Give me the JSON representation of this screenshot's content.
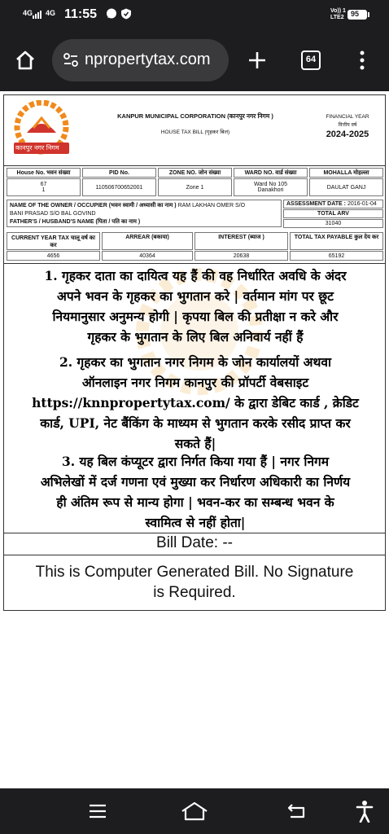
{
  "status_bar": {
    "time": "11:55",
    "signal_1": "4G",
    "signal_2": "4G",
    "volte": "Vo)) 1\nLTE2",
    "battery": "95"
  },
  "browser": {
    "url": "npropertytax.com",
    "tab_count": "64"
  },
  "bill": {
    "org_name": "KANPUR MUNICIPAL CORPORATION (कानपुर नगर निगम )",
    "bill_title": "HOUSE TAX BILL (गृहकर बिल)",
    "logo_text": "कानपुर नगर निगम",
    "financial_year_label": "FINANCIAL YEAR",
    "financial_year_label_hi": "वित्तीय वर्ष",
    "financial_year": "2024-2025",
    "row1_headers": [
      "House No. भवन संख्या",
      "PID No.",
      "ZONE NO. जोन संख्या",
      "WARD NO. वार्ड संख्या",
      "MOHALLA मोहल्ला"
    ],
    "house_no_1": "67",
    "house_no_2": "1",
    "pid_no": "110506700652001",
    "zone_no": "Zone 1",
    "ward_no_1": "Ward No 105",
    "ward_no_2": "Danakhori",
    "mohalla": "DAULAT GANJ",
    "owner_label": "NAME OF THE OWNER / OCCUPIER (भवन स्वामी / अध्यासी का नाम )",
    "owner_name": "RAM LAKHAN OMER S/O",
    "owner_name_2": "BANI PRASAD S/O BAL GOVIND",
    "father_label": "FATHER'S / HUSBAND'S NAME (पिता / पति का नाम )",
    "assessment_label": "ASSESSMENT DATE :",
    "assessment_date": "2016-01-04",
    "total_arv_label": "TOTAL ARV",
    "total_arv": "31040",
    "row3_headers": [
      "CURRENT YEAR TAX चालू वर्ष का कर",
      "ARREAR (बकाया)",
      "INTEREST (ब्याज )",
      "TOTAL TAX PAYABLE कुल देय कर"
    ],
    "current_tax": "4656",
    "arrear": "40364",
    "interest": "20638",
    "total_payable": "65192",
    "note_1_lines": [
      "1. गृहकर दाता का दायित्व यह हैं की वह निर्धारित अवधि के अंदर",
      "अपने भवन के गृहकर का भुगतान करे | वर्तमान मांग पर छूट",
      "नियमानुसार अनुमन्य होगी | कृपया बिल की प्रतीक्षा न करे और",
      "गृहकर के भुगतान के लिए बिल अनिवार्य नहीं हैं"
    ],
    "note_2_lines": [
      "2. गृहकर का भुगतान नगर निगम के जोन कार्यालयों अथवा",
      "ऑनलाइन नगर निगम कानपुर की प्रॉपर्टी वेबसाइट",
      "https://knnpropertytax.com/ के द्वारा डेबिट कार्ड , क्रेडिट",
      "कार्ड, UPI, नेट बैंकिंग के माध्यम से भुगतान करके रसीद प्राप्त कर",
      "सकते हैं|"
    ],
    "note_3_lines": [
      "3. यह बिल कंप्यूटर द्वारा निर्गत किया गया हैं | नगर निगम",
      "अभिलेखों में दर्ज गणना एवं मुख्या कर निर्धारण अधिकारी का निर्णय",
      "ही अंतिम रूप से मान्य होगा | भवन-कर का सम्बन्ध भवन के",
      "स्वामित्व से नहीं होता|"
    ],
    "bill_date": "Bill Date: --",
    "footer_line_1": "This is Computer Generated Bill. No Signature",
    "footer_line_2": "is Required."
  },
  "colors": {
    "dark_bar": "#1d1d1f",
    "url_pill": "#3a3a3c",
    "logo_orange": "#f08a1c",
    "logo_red": "#d0342c",
    "watermark": "#f6c98a"
  },
  "icons": [
    "home-icon",
    "tune-icon",
    "plus-icon",
    "tabs-icon",
    "more-icon",
    "menu-icon",
    "nav-home-icon",
    "back-icon",
    "accessibility-icon"
  ]
}
